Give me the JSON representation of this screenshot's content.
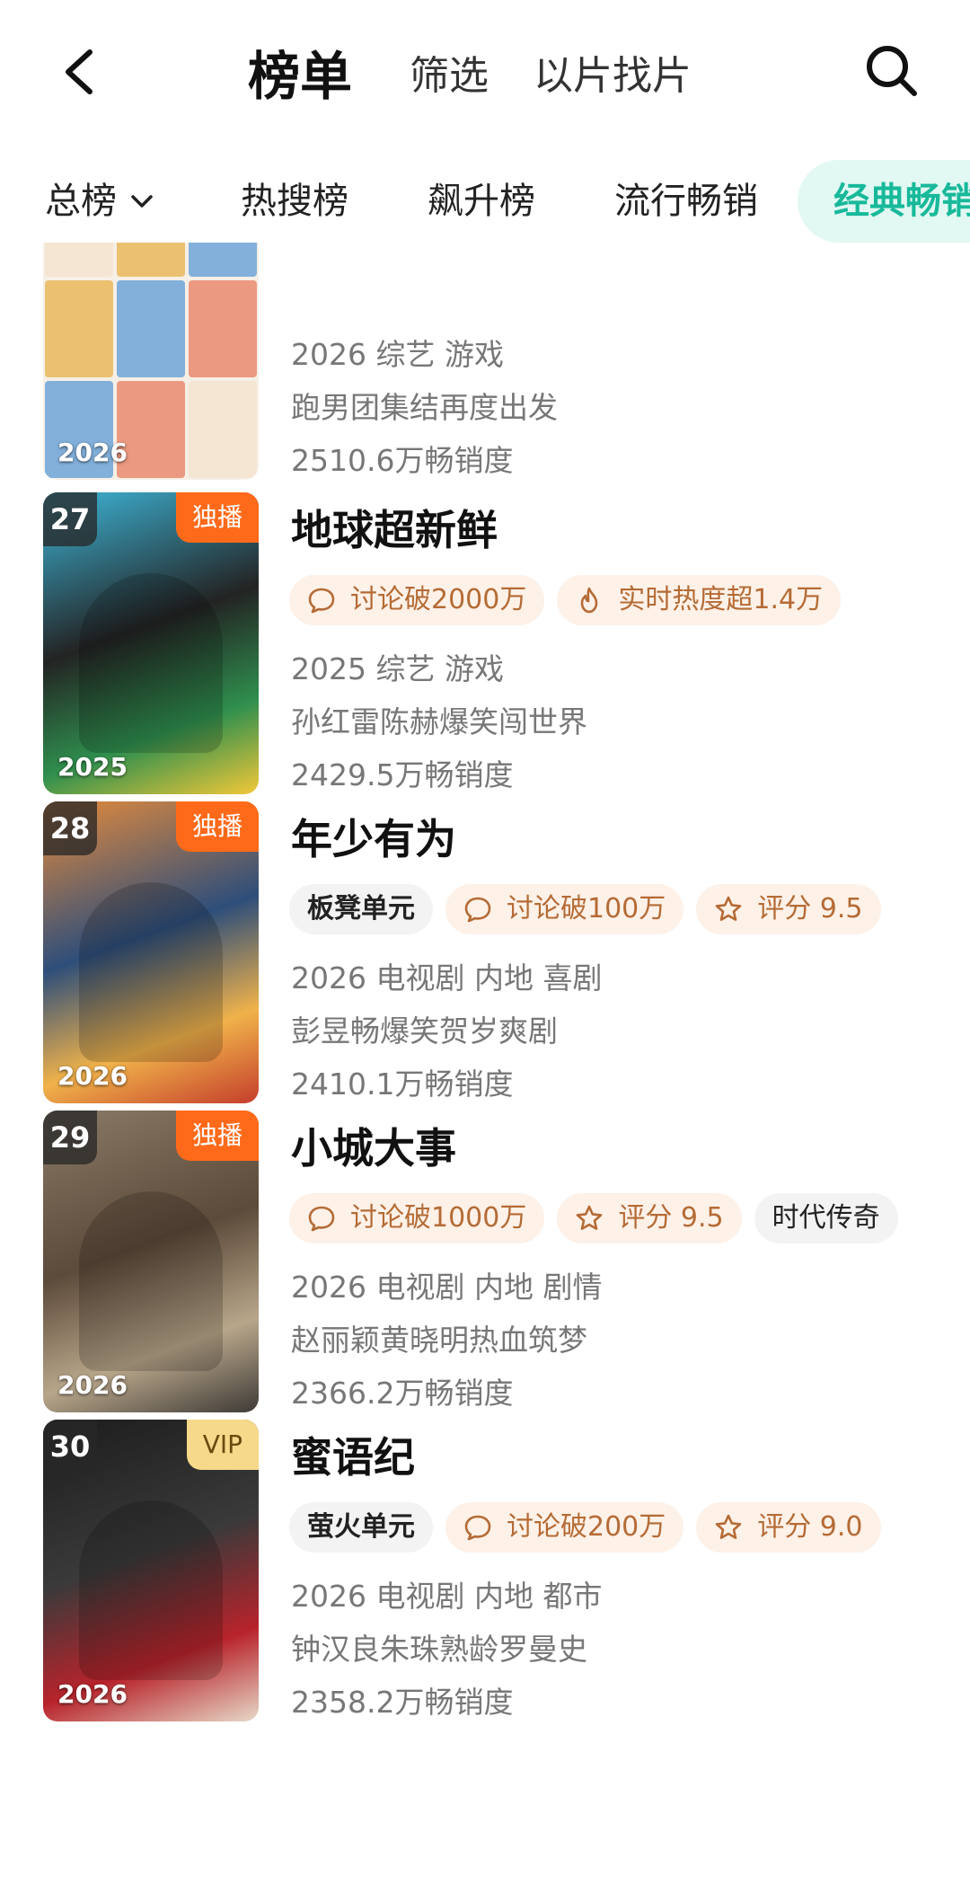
{
  "header": {
    "tabs": [
      "榜单",
      "筛选",
      "以片找片"
    ]
  },
  "categories": {
    "total": "总榜",
    "items": [
      "热搜榜",
      "飙升榜",
      "流行畅销",
      "经典畅销"
    ]
  },
  "items": [
    {
      "rank": "",
      "corner": "",
      "year_badge": "2026",
      "title": "",
      "tags": [],
      "genre": "2026 综艺 游戏",
      "desc": "跑男团集结再度出发",
      "sales": "2510.6万畅销度",
      "colors": [
        "#f4e3cf",
        "#e9b85a",
        "#6da5d8",
        "#e98a6f"
      ]
    },
    {
      "rank": "27",
      "corner": "独播",
      "corner_style": "orange",
      "year_badge": "2025",
      "title": "地球超新鲜",
      "tags": [
        {
          "icon": "chat-bubble-icon",
          "text": "讨论破2000万",
          "style": "orange"
        },
        {
          "icon": "flame-icon",
          "text": "实时热度超1.4万",
          "style": "orange"
        }
      ],
      "genre": "2025 综艺 游戏",
      "desc": "孙红雷陈赫爆笑闯世界",
      "sales": "2429.5万畅销度",
      "colors": [
        "#3db6d8",
        "#232323",
        "#2f8f4e",
        "#f2c838"
      ]
    },
    {
      "rank": "28",
      "corner": "独播",
      "corner_style": "orange",
      "year_badge": "2026",
      "title": "年少有为",
      "tags": [
        {
          "icon": "",
          "text": "板凳单元",
          "style": "gray",
          "brand": true
        },
        {
          "icon": "chat-bubble-icon",
          "text": "讨论破100万",
          "style": "orange"
        },
        {
          "icon": "star-icon",
          "text": "评分 9.5",
          "style": "orange"
        }
      ],
      "genre": "2026 电视剧 内地 喜剧",
      "desc": "彭昱畅爆笑贺岁爽剧",
      "sales": "2410.1万畅销度",
      "colors": [
        "#e58b3c",
        "#2e4e7a",
        "#f0b24a",
        "#c43e2b"
      ]
    },
    {
      "rank": "29",
      "corner": "独播",
      "corner_style": "orange",
      "year_badge": "2026",
      "title": "小城大事",
      "tags": [
        {
          "icon": "chat-bubble-icon",
          "text": "讨论破1000万",
          "style": "orange"
        },
        {
          "icon": "star-icon",
          "text": "评分 9.5",
          "style": "orange"
        },
        {
          "icon": "",
          "text": "时代传奇",
          "style": "gray"
        }
      ],
      "genre": "2026 电视剧 内地 剧情",
      "desc": "赵丽颖黄晓明热血筑梦",
      "sales": "2366.2万畅销度",
      "colors": [
        "#8a7a66",
        "#5c4a3a",
        "#b8a68a",
        "#3e3a36"
      ]
    },
    {
      "rank": "30",
      "corner": "VIP",
      "corner_style": "vip",
      "year_badge": "2026",
      "title": "蜜语纪",
      "tags": [
        {
          "icon": "",
          "text": "萤火单元",
          "style": "gray",
          "brand": true
        },
        {
          "icon": "chat-bubble-icon",
          "text": "讨论破200万",
          "style": "orange"
        },
        {
          "icon": "star-icon",
          "text": "评分 9.0",
          "style": "orange"
        }
      ],
      "genre": "2026 电视剧 内地 都市",
      "desc": "钟汉良朱珠熟龄罗曼史",
      "sales": "2358.2万畅销度",
      "colors": [
        "#1c1c1c",
        "#3a3a3a",
        "#b8232b",
        "#e7d9c8"
      ]
    }
  ]
}
